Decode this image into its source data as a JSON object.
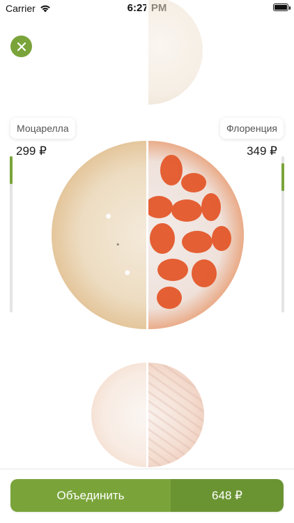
{
  "status_bar": {
    "carrier": "Carrier",
    "time": "6:27 PM",
    "battery_icon": "battery-full-icon",
    "wifi_icon": "wifi-icon"
  },
  "close_button": {
    "icon": "close-icon",
    "color": "#7aa43a"
  },
  "left_pizza": {
    "name": "Моцарелла",
    "price": "299 ₽",
    "scroll_position": 0.0
  },
  "right_pizza": {
    "name": "Флоренция",
    "price": "349 ₽",
    "scroll_position": 0.0
  },
  "combine_button": {
    "label": "Объединить",
    "total": "648 ₽"
  },
  "colors": {
    "accent": "#7aa43a",
    "accent_dark": "#6a9432"
  }
}
